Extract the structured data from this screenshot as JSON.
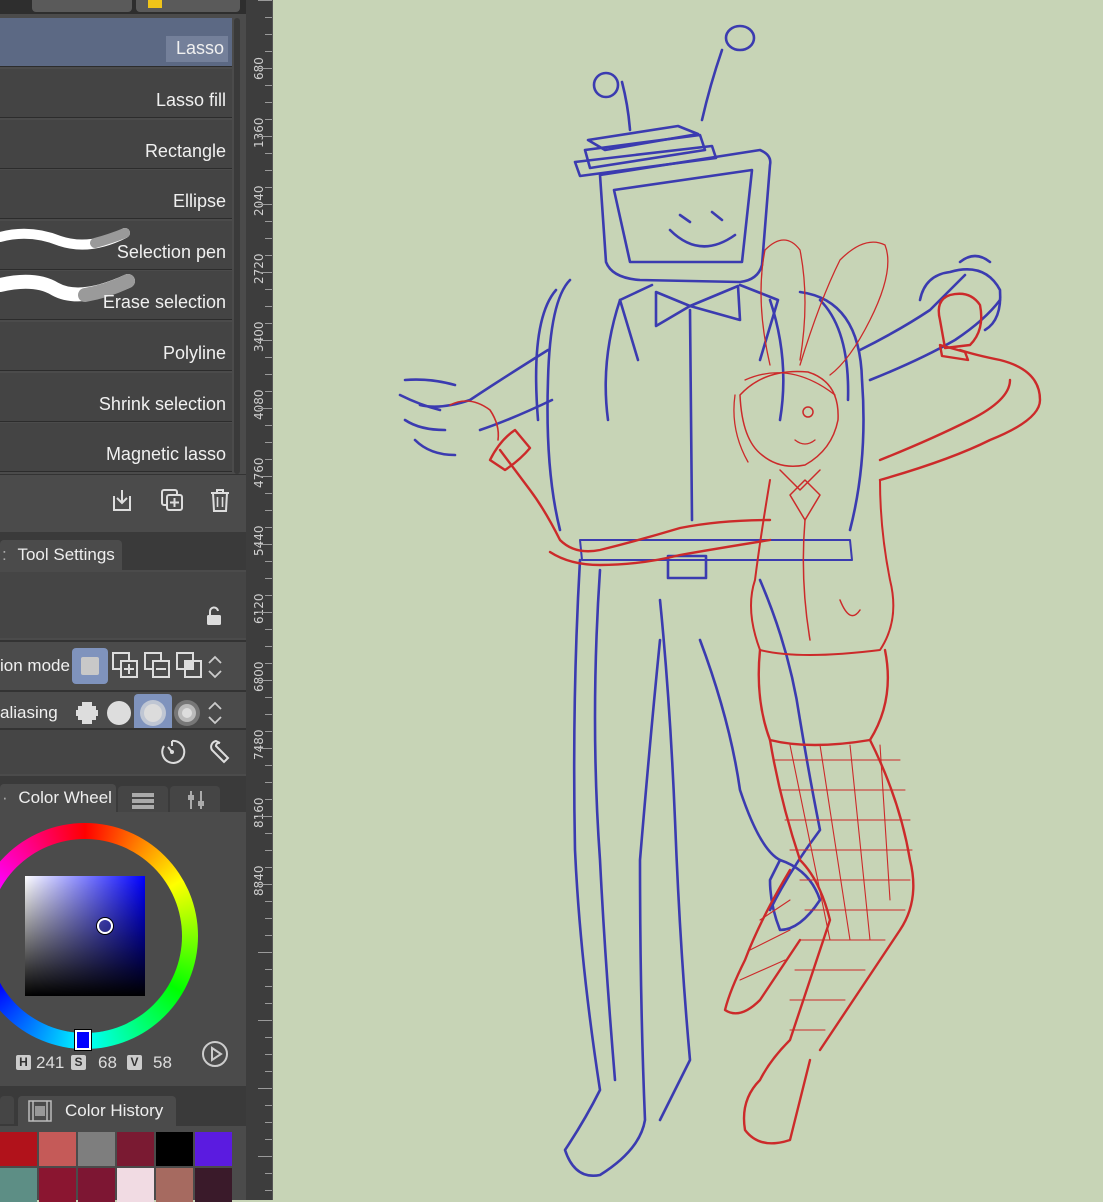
{
  "subtools": [
    {
      "label": "Lasso",
      "selected": true
    },
    {
      "label": "Lasso fill",
      "selected": false
    },
    {
      "label": "Rectangle",
      "selected": false
    },
    {
      "label": "Ellipse",
      "selected": false
    },
    {
      "label": "Selection pen",
      "selected": false
    },
    {
      "label": "Erase selection",
      "selected": false
    },
    {
      "label": "Polyline",
      "selected": false
    },
    {
      "label": "Shrink selection",
      "selected": false
    },
    {
      "label": "Magnetic lasso",
      "selected": false
    }
  ],
  "tool_settings": {
    "tab_label": "Tool Settings",
    "selection_mode_label": "ion mode",
    "antialiasing_label": "aliasing"
  },
  "color_panel": {
    "tab_label": "Color Wheel",
    "h_label": "H",
    "h_value": "241",
    "s_label": "S",
    "s_value": "68",
    "v_label": "V",
    "v_value": "58",
    "current_color": "#3a38a0"
  },
  "color_history": {
    "tab_label": "Color History",
    "row1": [
      "#b1121b",
      "#c55a58",
      "#7e7e7e",
      "#7a1a32",
      "#000000",
      "#5b1be0"
    ],
    "row2": [
      "#5d8e85",
      "#8a1530",
      "#7d1633",
      "#f1dbe3",
      "#a66a60",
      "#3a1a2a"
    ]
  },
  "ruler": {
    "labels": [
      "680",
      "1360",
      "2040",
      "2720",
      "3400",
      "4080",
      "4760",
      "5440",
      "6120",
      "6800",
      "7480",
      "8160",
      "8840"
    ]
  },
  "canvas": {
    "background": "#c7d4b6",
    "sketch_colors": [
      "#3b3bb0",
      "#cc2a2a"
    ]
  },
  "icons": [
    "import-icon",
    "duplicate-icon",
    "trash-icon",
    "lock-icon",
    "speedometer-icon",
    "wrench-icon",
    "play-icon",
    "film-icon",
    "sliders-icon"
  ]
}
